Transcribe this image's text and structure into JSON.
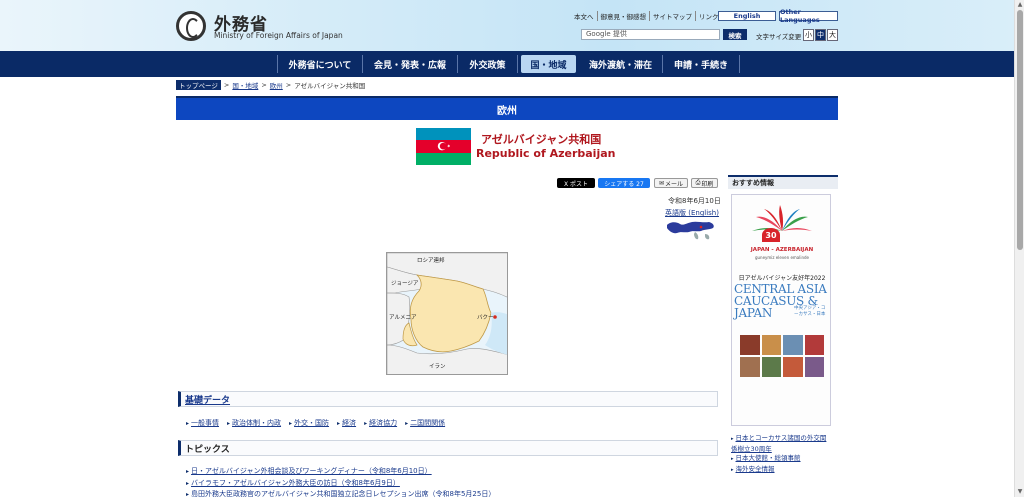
{
  "header": {
    "logo_jp": "外務省",
    "logo_en": "Ministry of Foreign Affairs of Japan",
    "utility_links": [
      "本文へ",
      "御意見・御感想",
      "サイトマップ",
      "リンク集"
    ],
    "english_label": "English",
    "other_lang_label": "Other Languages",
    "search_placeholder": "Google 提供",
    "search_button": "検索",
    "font_size_label": "文字サイズ変更",
    "font_sizes": [
      "小",
      "中",
      "大"
    ]
  },
  "nav": {
    "items": [
      "外務省について",
      "会見・発表・広報",
      "外交政策",
      "国・地域",
      "海外渡航・滞在",
      "申請・手続き"
    ],
    "active": "国・地域"
  },
  "breadcrumb": {
    "home": "トップページ",
    "sep": ">",
    "items": [
      "国・地域",
      "欧州"
    ],
    "current": "アゼルバイジャン共和国"
  },
  "region_title": "欧州",
  "country": {
    "name_jp": "アゼルバイジャン共和国",
    "name_en": "Republic of Azerbaijan",
    "flag_colors": [
      "#0092bc",
      "#e4002b",
      "#00af66"
    ]
  },
  "share": {
    "x_post": "X ポスト",
    "fb_share": "シェアする 27",
    "mail": "メール",
    "print": "印刷"
  },
  "date": "令和8年6月10日",
  "english_version": "英語版 (English)",
  "map_labels": {
    "russia": "ロシア連邦",
    "georgia": "ジョージア",
    "armenia": "アルメニア",
    "iran": "イラン",
    "baku": "バクー"
  },
  "sections": {
    "basic_data": "基礎データ",
    "basic_links": [
      "一般事情",
      "政治体制・内政",
      "外交・国防",
      "経済",
      "経済協力",
      "二国間関係"
    ],
    "topics": "トピックス",
    "topic_items": [
      "日・アゼルバイジャン外相会談及びワーキングディナー（令和8年6月10日）",
      "バイラモフ・アゼルバイジャン外務大臣の訪日（令和8年6月9日）",
      "島田外務大臣政務官のアゼルバイジャン共和国独立記念日レセプション出席（令和8年5月25日）"
    ]
  },
  "sidebar": {
    "head": "おすすめ情報",
    "banner": {
      "num": "30",
      "title": "JAPAN - AZERBAIJAN",
      "sub": "guneymiz eleven emalinde",
      "year": "日アゼルバイジャン友好年2022",
      "ca": "CENTRAL ASIA CAUCASUS & JAPAN",
      "ca_jp": "中央アジア・コーカサス・日本"
    },
    "links": [
      "日本とコーカサス諸国の外交関係樹立30周年",
      "日本大使館・総領事館",
      "海外安全情報"
    ]
  }
}
